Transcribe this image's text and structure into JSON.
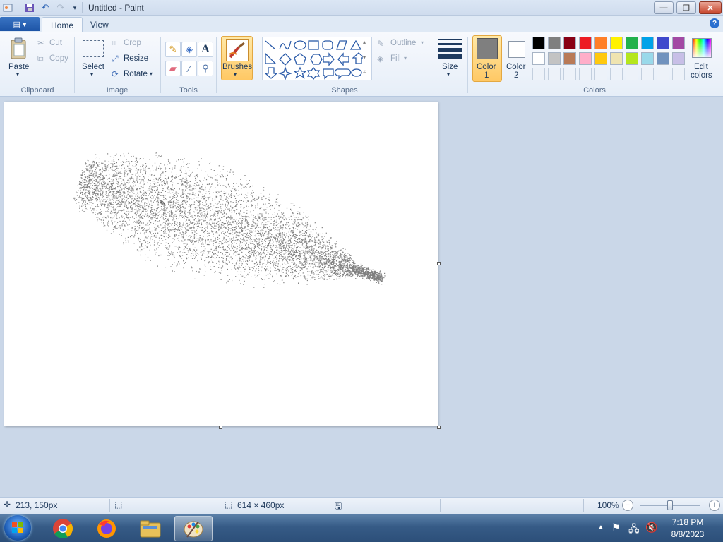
{
  "window": {
    "title": "Untitled - Paint"
  },
  "tabs": {
    "home": "Home",
    "view": "View"
  },
  "clipboard": {
    "paste": "Paste",
    "cut": "Cut",
    "copy": "Copy",
    "group": "Clipboard"
  },
  "image": {
    "select": "Select",
    "crop": "Crop",
    "resize": "Resize",
    "rotate": "Rotate",
    "group": "Image"
  },
  "tools": {
    "group": "Tools"
  },
  "brushes": {
    "label": "Brushes"
  },
  "shapes": {
    "outline": "Outline",
    "fill": "Fill",
    "group": "Shapes"
  },
  "size": {
    "label": "Size"
  },
  "colors": {
    "color1": "Color",
    "color1_num": "1",
    "color2": "Color",
    "color2_num": "2",
    "edit": "Edit",
    "edit2": "colors",
    "group": "Colors",
    "color1_value": "#7f7f7f",
    "color2_value": "#ffffff",
    "palette_row1": [
      "#000000",
      "#7f7f7f",
      "#880015",
      "#ed1c24",
      "#ff7f27",
      "#fff200",
      "#22b14c",
      "#00a2e8",
      "#3f48cc",
      "#a349a4"
    ],
    "palette_row2": [
      "#ffffff",
      "#c3c3c3",
      "#b97a57",
      "#ffaec9",
      "#ffc90e",
      "#efe4b0",
      "#b5e61d",
      "#99d9ea",
      "#7092be",
      "#c8bfe7"
    ]
  },
  "status": {
    "cursor": "213, 150px",
    "dimensions": "614 × 460px",
    "zoom": "100%"
  },
  "zoom_level": 0.5,
  "taskbar": {
    "time": "7:18 PM",
    "date": "8/8/2023"
  }
}
